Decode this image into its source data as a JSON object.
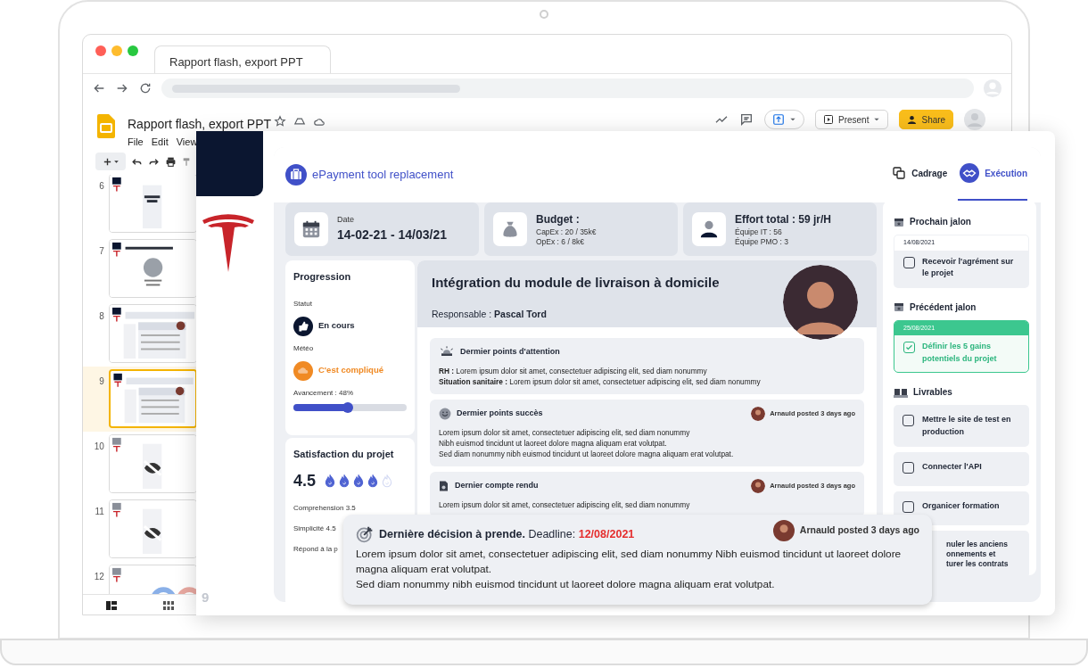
{
  "browser": {
    "tab_title": "Rapport flash, export PPT"
  },
  "app": {
    "doc_title": "Rapport flash, export PPT",
    "menu": [
      "File",
      "Edit",
      "View"
    ],
    "present_label": "Present",
    "share_label": "Share"
  },
  "filmstrip": {
    "slides": [
      {
        "number": "6",
        "selected": false
      },
      {
        "number": "7",
        "selected": false
      },
      {
        "number": "8",
        "selected": false
      },
      {
        "number": "9",
        "selected": true
      },
      {
        "number": "10",
        "selected": false
      },
      {
        "number": "11",
        "selected": false
      },
      {
        "number": "12",
        "selected": false
      }
    ]
  },
  "slide": {
    "number": "9",
    "project_title": "ePayment tool replacement",
    "tabs": [
      {
        "label": "Cadrage",
        "selected": false
      },
      {
        "label": "Exécution",
        "selected": true
      }
    ],
    "info_cards": [
      {
        "kind": "date",
        "label": "Date",
        "value": "14-02-21 - 14/03/21"
      },
      {
        "kind": "budget",
        "title": "Budget :",
        "lines": [
          "CapEx : 20 / 35k€",
          "OpEx : 6 / 8k€"
        ]
      },
      {
        "kind": "effort",
        "title": "Effort total : 59 jr/H",
        "lines": [
          "Équipe IT : 56",
          "Équipe PMO : 3"
        ]
      }
    ],
    "progression": {
      "title": "Progression",
      "status_label": "Statut",
      "status": "En cours",
      "weather_label": "Météo",
      "weather": "C'est compliqué",
      "advancement": "Avancement : 48%",
      "level": 0.48
    },
    "satisfaction": {
      "title": "Satisfaction du projet",
      "score": "4.5",
      "stars": 4,
      "criteria": [
        "Comprehension 3.5",
        "Simplicité 4.5",
        "Répond à la p"
      ]
    },
    "main": {
      "title": "Intégration du module de livraison à domicile",
      "manager": "Responsable : **Pascal Tord**",
      "sections": [
        {
          "kind": "attention",
          "title": "Dermier points d'attention",
          "lines": [
            "**RH :** Lorem ipsum dolor sit amet, consectetuer adipiscing elit, sed diam nonummy",
            "**Situation sanitaire :** Lorem ipsum dolor sit amet, consectetuer adipiscing elit, sed diam nonummy"
          ]
        },
        {
          "kind": "success",
          "title": "Dermier points succès",
          "meta": "Arnauld posted 3 days ago",
          "lines": [
            "Lorem ipsum dolor sit amet, consectetuer adipiscing elit, sed diam nonummy",
            "Nibh euismod tincidunt ut laoreet dolore magna aliquam erat volutpat.",
            "Sed diam nonummy nibh euismod tincidunt ut laoreet dolore magna aliquam erat volutpat."
          ]
        },
        {
          "kind": "report",
          "title": "Dernier compte rendu",
          "meta": "Arnauld posted 3 days ago",
          "lines": [
            "Lorem ipsum dolor sit amet, consectetuer adipiscing elit, sed diam nonummy"
          ]
        }
      ]
    },
    "milestones": [
      {
        "title": "Prochain jalon",
        "date": "14/08/2021",
        "task": "Recevoir l'agrément sur le projet",
        "checked": false
      },
      {
        "title": "Précédent jalon",
        "date": "25/08/2021",
        "task": "Définir les 5 gains potentiels du projet",
        "checked": true
      }
    ],
    "deliverables": {
      "title": "Livrables",
      "items": [
        {
          "label": "Mettre le site de test en production",
          "checked": false
        },
        {
          "label": "Connecter l'API",
          "checked": false
        },
        {
          "label": "Organicer formation",
          "checked": false
        },
        {
          "lines": [
            "nuler les anciens",
            "onnements et",
            "turer les contrats"
          ]
        }
      ]
    },
    "decision": {
      "title": "Dernière décision à prende.",
      "deadline_label": "Deadline:",
      "deadline": "12/08/2021",
      "meta": "Arnauld posted 3 days ago",
      "lines": [
        "Lorem ipsum dolor sit amet, consectetuer adipiscing elit, sed diam nonummy Nibh euismod tincidunt ut laoreet dolore magna aliquam erat volutpat.",
        "Sed diam nonummy nibh euismod tincidunt ut laoreet dolore magna aliquam erat volutpat."
      ]
    }
  }
}
